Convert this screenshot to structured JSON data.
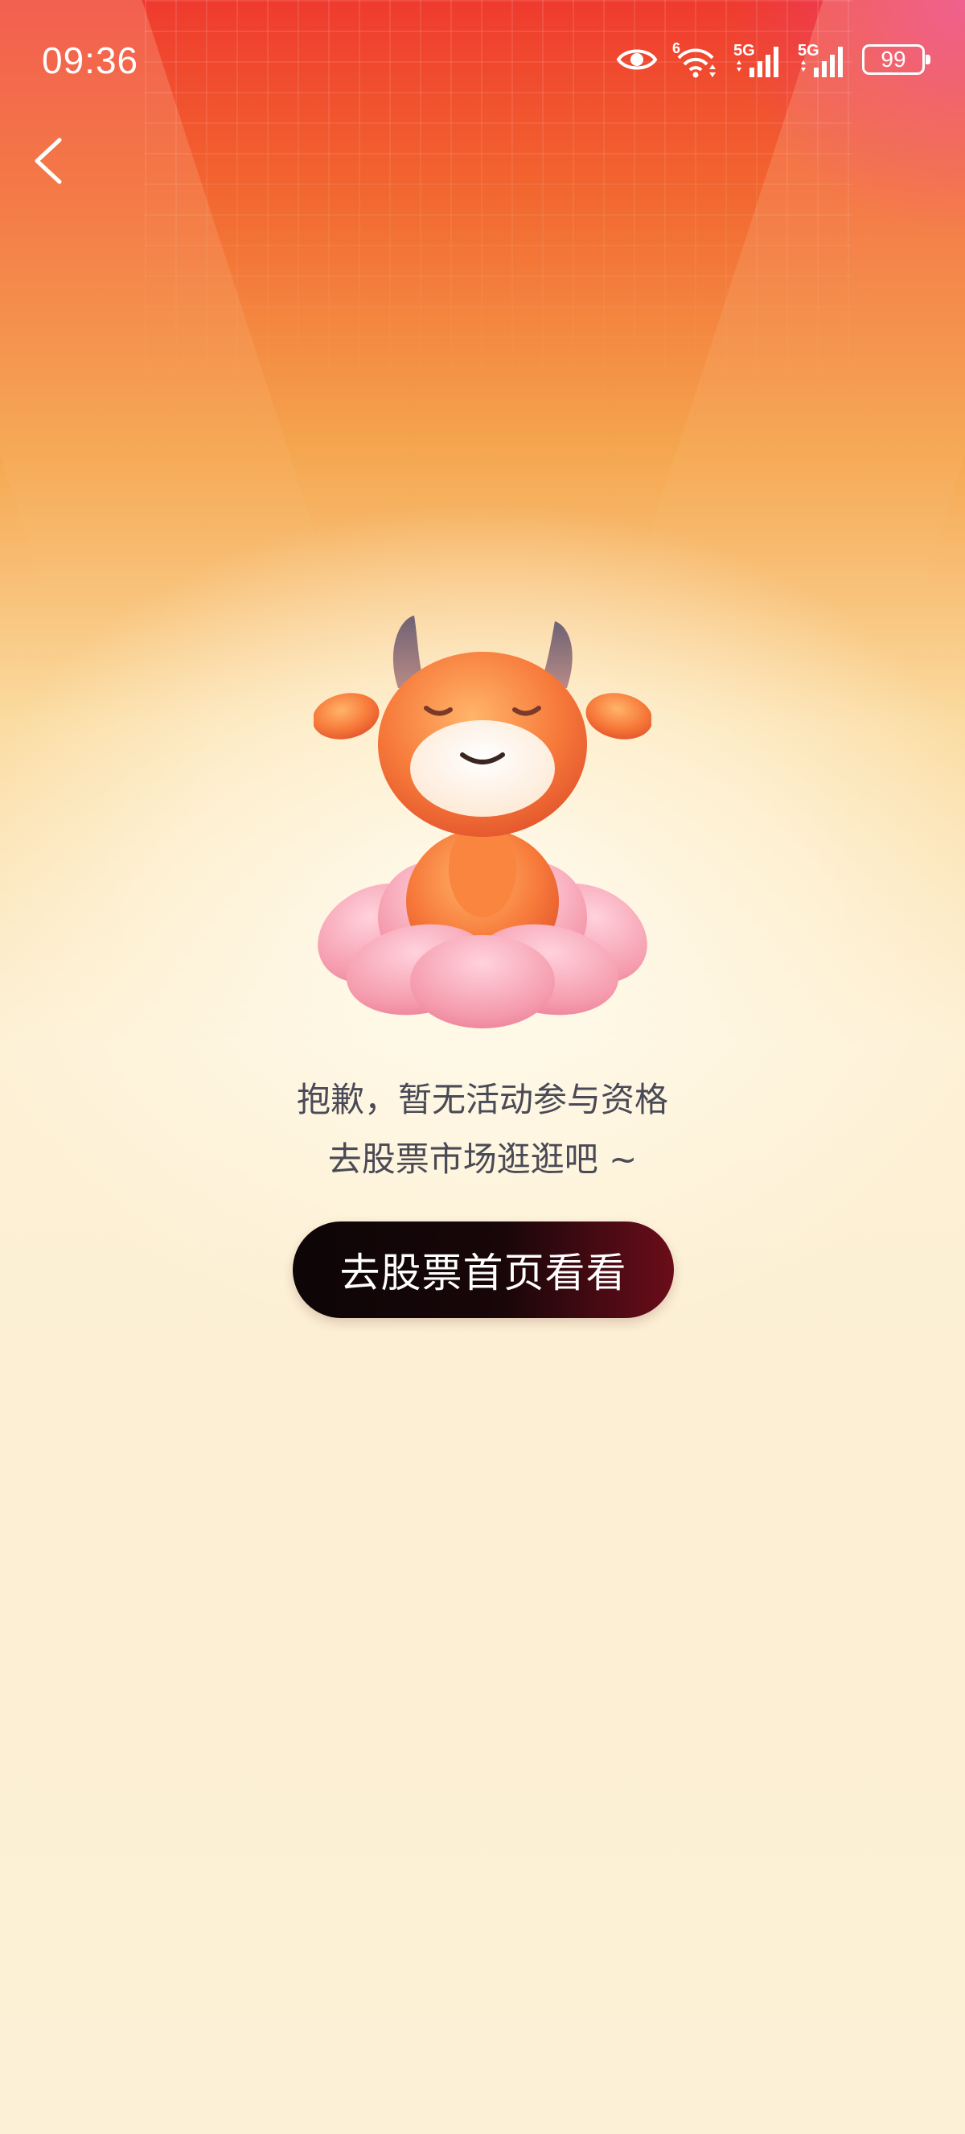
{
  "status_bar": {
    "time": "09:36",
    "wifi_badge": "6",
    "signal1_label": "5G",
    "signal2_label": "5G",
    "battery_level": "99",
    "icons": [
      "eye-icon",
      "wifi-icon",
      "signal-icon",
      "signal-icon",
      "battery-icon"
    ]
  },
  "nav": {
    "back_icon": "chevron-left-icon"
  },
  "empty_state": {
    "illustration": "mascot-bull-on-lotus",
    "line1": "抱歉，暂无活动参与资格",
    "line2": "去股票市场逛逛吧 ~",
    "button_label": "去股票首页看看"
  },
  "colors": {
    "header_red": "#ef3a2e",
    "header_pink": "#eb3c8c",
    "background_cream": "#fcf0d6",
    "button_dark": "#0d0506",
    "button_accent": "#6b0d1a",
    "text_gray": "#4a4a56"
  }
}
